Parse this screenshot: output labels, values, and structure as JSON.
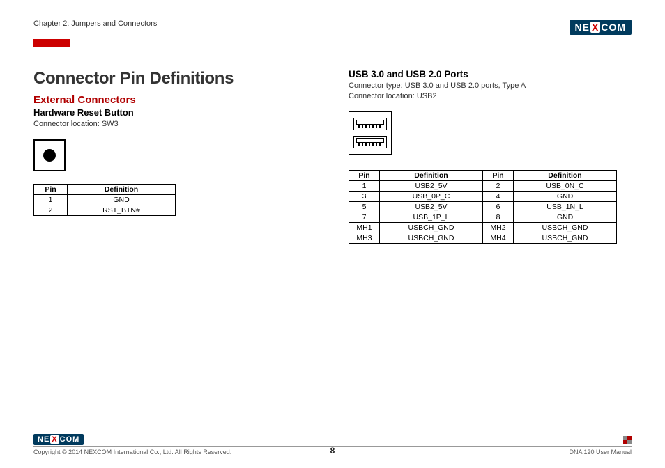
{
  "header": {
    "chapter": "Chapter 2: Jumpers and Connectors",
    "brand_pre": "NE",
    "brand_x": "X",
    "brand_post": "COM"
  },
  "left": {
    "title": "Connector Pin Definitions",
    "subtitle": "External Connectors",
    "section": "Hardware Reset Button",
    "location": "Connector location: SW3",
    "table": {
      "head_pin": "Pin",
      "head_def": "Definition",
      "rows": [
        {
          "pin": "1",
          "def": "GND"
        },
        {
          "pin": "2",
          "def": "RST_BTN#"
        }
      ]
    }
  },
  "right": {
    "section": "USB 3.0 and USB 2.0 Ports",
    "type_line": "Connector type: USB 3.0 and USB 2.0 ports, Type A",
    "location": "Connector location: USB2",
    "table": {
      "head_pin": "Pin",
      "head_def": "Definition",
      "rows": [
        {
          "p1": "1",
          "d1": "USB2_5V",
          "p2": "2",
          "d2": "USB_0N_C"
        },
        {
          "p1": "3",
          "d1": "USB_0P_C",
          "p2": "4",
          "d2": "GND"
        },
        {
          "p1": "5",
          "d1": "USB2_5V",
          "p2": "6",
          "d2": "USB_1N_L"
        },
        {
          "p1": "7",
          "d1": "USB_1P_L",
          "p2": "8",
          "d2": "GND"
        },
        {
          "p1": "MH1",
          "d1": "USBCH_GND",
          "p2": "MH2",
          "d2": "USBCH_GND"
        },
        {
          "p1": "MH3",
          "d1": "USBCH_GND",
          "p2": "MH4",
          "d2": "USBCH_GND"
        }
      ]
    }
  },
  "footer": {
    "copyright": "Copyright © 2014 NEXCOM International Co., Ltd. All Rights Reserved.",
    "page": "8",
    "doc": "DNA 120 User Manual"
  }
}
